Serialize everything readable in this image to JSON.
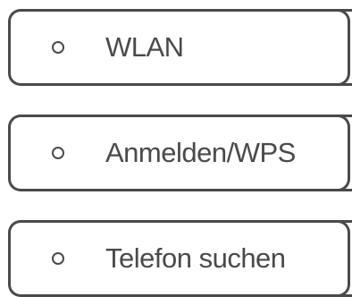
{
  "buttons": [
    {
      "label": "WLAN",
      "led_icon": "led-circle-icon"
    },
    {
      "label": "Anmelden/WPS",
      "led_icon": "led-circle-icon"
    },
    {
      "label": "Telefon suchen",
      "led_icon": "led-circle-icon"
    }
  ],
  "colors": {
    "outline": "#4a4a4a",
    "text": "#4a4a4a",
    "background": "#ffffff"
  }
}
